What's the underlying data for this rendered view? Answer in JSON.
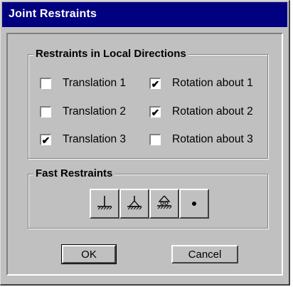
{
  "window": {
    "title": "Joint Restraints"
  },
  "local_directions": {
    "title": "Restraints in Local Directions",
    "options": [
      {
        "label": "Translation 1",
        "checked": false
      },
      {
        "label": "Rotation about 1",
        "checked": true
      },
      {
        "label": "Translation 2",
        "checked": false
      },
      {
        "label": "Rotation about 2",
        "checked": true
      },
      {
        "label": "Translation 3",
        "checked": true
      },
      {
        "label": "Rotation about 3",
        "checked": false
      }
    ]
  },
  "fast_restraints": {
    "title": "Fast Restraints",
    "buttons": [
      {
        "icon": "fixed-support-icon"
      },
      {
        "icon": "pinned-support-icon"
      },
      {
        "icon": "roller-support-icon"
      },
      {
        "icon": "free-joint-icon"
      }
    ]
  },
  "footer": {
    "ok_label": "OK",
    "cancel_label": "Cancel"
  },
  "colors": {
    "title_bar": "#000080",
    "face": "#c0c0c0"
  }
}
